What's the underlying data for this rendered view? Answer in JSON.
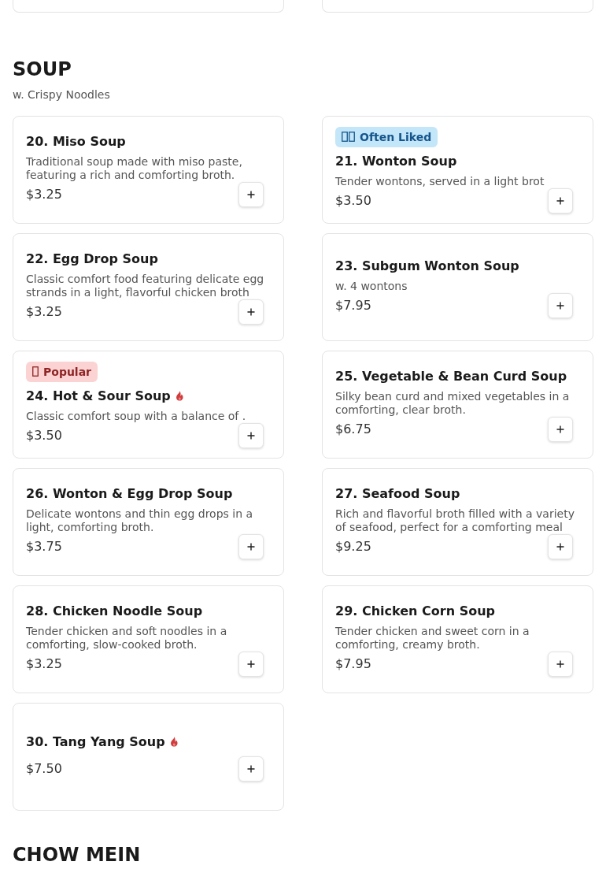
{
  "sections": [
    {
      "title": "SOUP",
      "subtitle": "w. Crispy Noodles",
      "items": [
        {
          "name": "20. Miso Soup",
          "description": "Traditional soup made with miso paste, featuring a rich and comforting broth.",
          "price": "$3.25",
          "spicy": false
        },
        {
          "name": "21. Wonton Soup",
          "badge": {
            "kind": "often_liked",
            "label": "Often Liked"
          },
          "description": "Tender wontons, served in a light brot",
          "price": "$3.50",
          "spicy": false
        },
        {
          "name": "22. Egg Drop Soup",
          "description": "Classic comfort food featuring delicate egg strands in a light, flavorful chicken broth",
          "price": "$3.25",
          "spicy": false
        },
        {
          "name": "23. Subgum Wonton Soup",
          "description": "w. 4 wontons",
          "price": "$7.95",
          "spicy": false
        },
        {
          "name": "24. Hot & Sour Soup",
          "badge": {
            "kind": "popular",
            "label": "Popular"
          },
          "description": "Classic comfort soup with a balance of .",
          "price": "$3.50",
          "spicy": true
        },
        {
          "name": "25. Vegetable & Bean Curd Soup",
          "description": "Silky bean curd and mixed vegetables in a comforting, clear broth.",
          "price": "$6.75",
          "spicy": false
        },
        {
          "name": "26. Wonton & Egg Drop Soup",
          "description": "Delicate wontons and thin egg drops in a light, comforting broth.",
          "price": "$3.75",
          "spicy": false
        },
        {
          "name": "27. Seafood Soup",
          "description": "Rich and flavorful broth filled with a variety of seafood, perfect for a comforting meal",
          "price": "$9.25",
          "spicy": false
        },
        {
          "name": "28. Chicken Noodle Soup",
          "description": "Tender chicken and soft noodles in a comforting, slow-cooked broth.",
          "price": "$3.25",
          "spicy": false
        },
        {
          "name": "29. Chicken Corn Soup",
          "description": "Tender chicken and sweet corn in a comforting, creamy broth.",
          "price": "$7.95",
          "spicy": false
        },
        {
          "name": "30. Tang Yang Soup",
          "price": "$7.50",
          "spicy": true
        }
      ]
    },
    {
      "title": "CHOW MEIN"
    }
  ]
}
